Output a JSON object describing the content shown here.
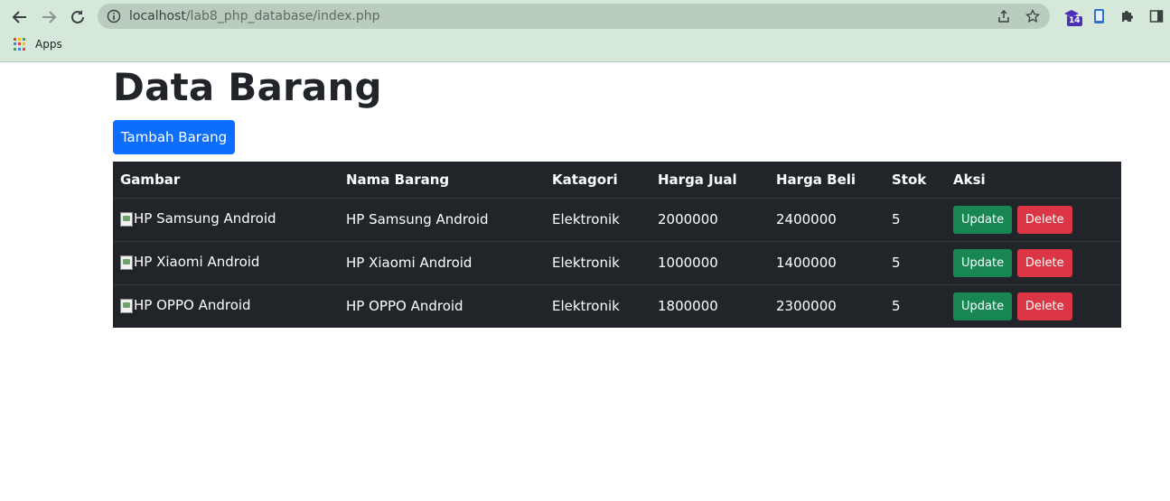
{
  "browser": {
    "url_host": "localhost",
    "url_path": "/lab8_php_database/index.php",
    "extension_badge": "14",
    "bookmarks": [
      {
        "label": "Apps"
      }
    ]
  },
  "page": {
    "title": "Data Barang",
    "add_button": "Tambah Barang"
  },
  "table": {
    "headers": [
      "Gambar",
      "Nama Barang",
      "Katagori",
      "Harga Jual",
      "Harga Beli",
      "Stok",
      "Aksi"
    ],
    "rows": [
      {
        "image_alt": "HP Samsung Android",
        "name": "HP Samsung Android",
        "category": "Elektronik",
        "price_sell": "2000000",
        "price_buy": "2400000",
        "stock": "5",
        "update_label": "Update",
        "delete_label": "Delete"
      },
      {
        "image_alt": "HP Xiaomi Android",
        "name": "HP Xiaomi Android",
        "category": "Elektronik",
        "price_sell": "1000000",
        "price_buy": "1400000",
        "stock": "5",
        "update_label": "Update",
        "delete_label": "Delete"
      },
      {
        "image_alt": "HP OPPO Android",
        "name": "HP OPPO Android",
        "category": "Elektronik",
        "price_sell": "1800000",
        "price_buy": "2300000",
        "stock": "5",
        "update_label": "Update",
        "delete_label": "Delete"
      }
    ]
  },
  "colors": {
    "primary": "#0d6efd",
    "success": "#198754",
    "danger": "#dc3545",
    "table_dark": "#212529",
    "chrome": "#d5e8d9"
  }
}
